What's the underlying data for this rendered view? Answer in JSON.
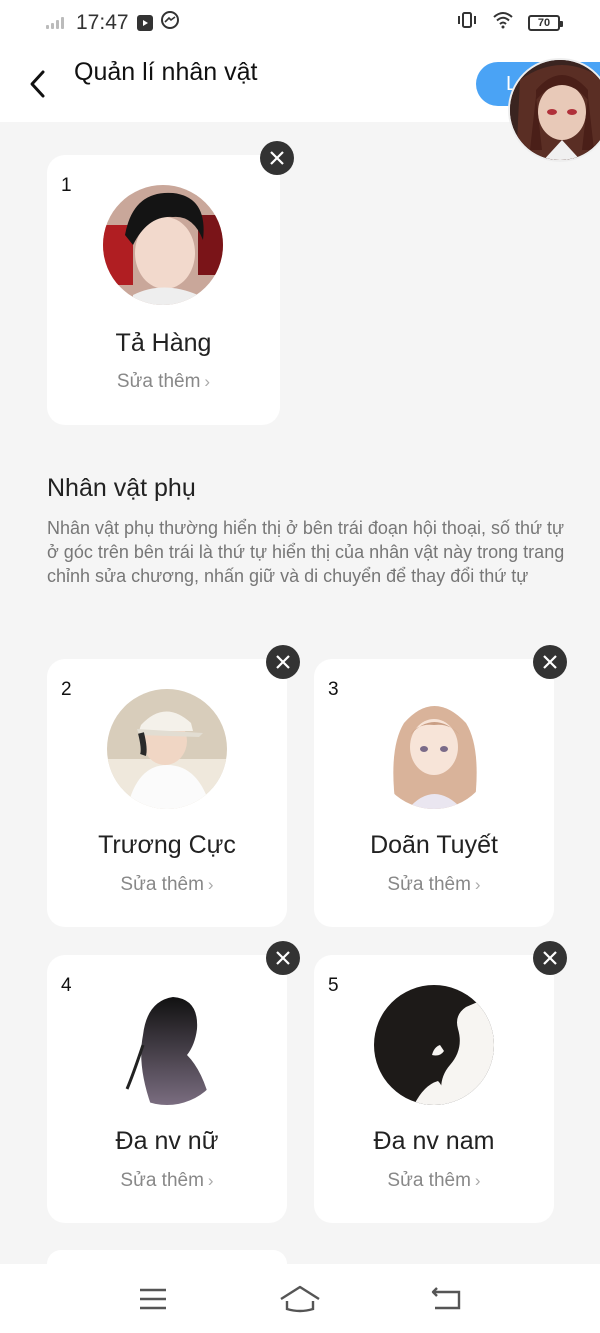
{
  "status_bar": {
    "time": "17:47",
    "battery": "70"
  },
  "header": {
    "title": "Quản lí nhân vật",
    "save_label": "Lư"
  },
  "main_character": {
    "number": "1",
    "name": "Tả Hàng",
    "edit_label": "Sửa thêm"
  },
  "secondary_section": {
    "title": "Nhân vật phụ",
    "description": "Nhân vật phụ thường hiển thị ở bên trái đoạn hội thoại, số thứ tự ở góc trên bên trái là thứ tự hiển thị của nhân vật này trong trang chỉnh sửa chương, nhấn giữ và di chuyển để thay đổi thứ tự"
  },
  "characters": [
    {
      "number": "2",
      "name": "Trương Cực",
      "edit_label": "Sửa thêm"
    },
    {
      "number": "3",
      "name": "Doãn Tuyết",
      "edit_label": "Sửa thêm"
    },
    {
      "number": "4",
      "name": "Đa nv nữ",
      "edit_label": "Sửa thêm"
    },
    {
      "number": "5",
      "name": "Đa nv nam",
      "edit_label": "Sửa thêm"
    }
  ],
  "colors": {
    "accent": "#4aa3f5",
    "background": "#f5f5f5",
    "card": "#ffffff"
  }
}
